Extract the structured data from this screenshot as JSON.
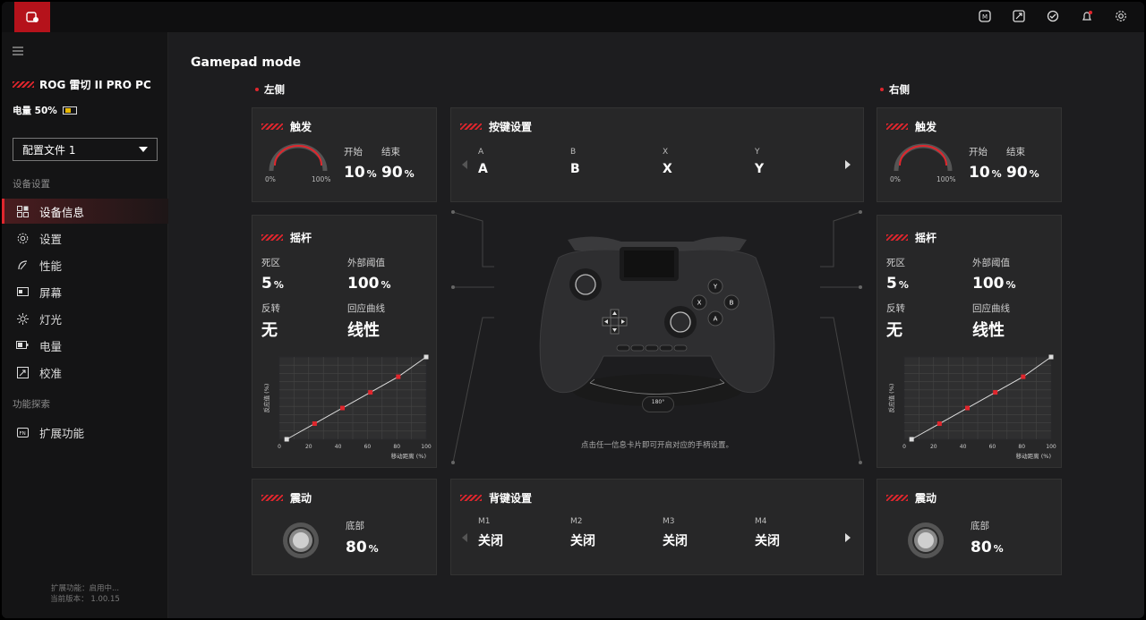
{
  "sidebar": {
    "device_name": "ROG 雷切 II PRO PC",
    "battery": "电量 50%",
    "profile": "配置文件 1",
    "section_device": "设备设置",
    "section_feature": "功能探索",
    "items": [
      {
        "label": "设备信息",
        "icon": "device-info-icon"
      },
      {
        "label": "设置",
        "icon": "gear-icon"
      },
      {
        "label": "性能",
        "icon": "performance-icon"
      },
      {
        "label": "屏幕",
        "icon": "screen-icon"
      },
      {
        "label": "灯光",
        "icon": "lighting-icon"
      },
      {
        "label": "电量",
        "icon": "battery-icon"
      },
      {
        "label": "校准",
        "icon": "calibration-icon"
      }
    ],
    "feature_item": "扩展功能",
    "ext_status": "扩展功能：启用中...",
    "version": "当前版本： 1.00.15"
  },
  "main": {
    "title": "Gamepad mode",
    "left_label": "左侧",
    "right_label": "右侧",
    "trigger": {
      "title": "触发",
      "start_label": "开始",
      "end_label": "结束",
      "start": "10",
      "end": "90",
      "unit": "%",
      "min": "0%",
      "max": "100%"
    },
    "stick": {
      "title": "摇杆",
      "deadzone_label": "死区",
      "deadzone": "5",
      "outer_label": "外部阈值",
      "outer": "100",
      "invert_label": "反转",
      "invert": "无",
      "curve_label": "回应曲线",
      "curve": "线性",
      "unit": "%",
      "ylabel": "反应值 (%)",
      "xlabel": "移动距离 (%)"
    },
    "vibration": {
      "title": "震动",
      "label": "底部",
      "value": "80",
      "unit": "%"
    },
    "buttons": {
      "title": "按键设置",
      "keys": [
        {
          "name": "A",
          "value": "A"
        },
        {
          "name": "B",
          "value": "B"
        },
        {
          "name": "X",
          "value": "X"
        },
        {
          "name": "Y",
          "value": "Y"
        }
      ]
    },
    "back": {
      "title": "背键设置",
      "keys": [
        {
          "name": "M1",
          "value": "关闭"
        },
        {
          "name": "M2",
          "value": "关闭"
        },
        {
          "name": "M3",
          "value": "关闭"
        },
        {
          "name": "M4",
          "value": "关闭"
        }
      ]
    },
    "hint": "点击任一信息卡片即可开启对应的手柄设置。",
    "rotate": "180°",
    "face_buttons": [
      "Y",
      "X",
      "B",
      "A"
    ]
  },
  "chart_data": {
    "type": "line",
    "title": "",
    "xlabel": "移动距离 (%)",
    "ylabel": "反应值 (%)",
    "xlim": [
      0,
      100
    ],
    "ylim": [
      0,
      100
    ],
    "x_ticks": [
      0,
      20,
      40,
      60,
      80,
      100
    ],
    "series": [
      {
        "values": [
          [
            5,
            0
          ],
          [
            24,
            19
          ],
          [
            43,
            38
          ],
          [
            62,
            57
          ],
          [
            81,
            76
          ],
          [
            100,
            100
          ]
        ]
      }
    ],
    "accent": "#e0262d"
  }
}
